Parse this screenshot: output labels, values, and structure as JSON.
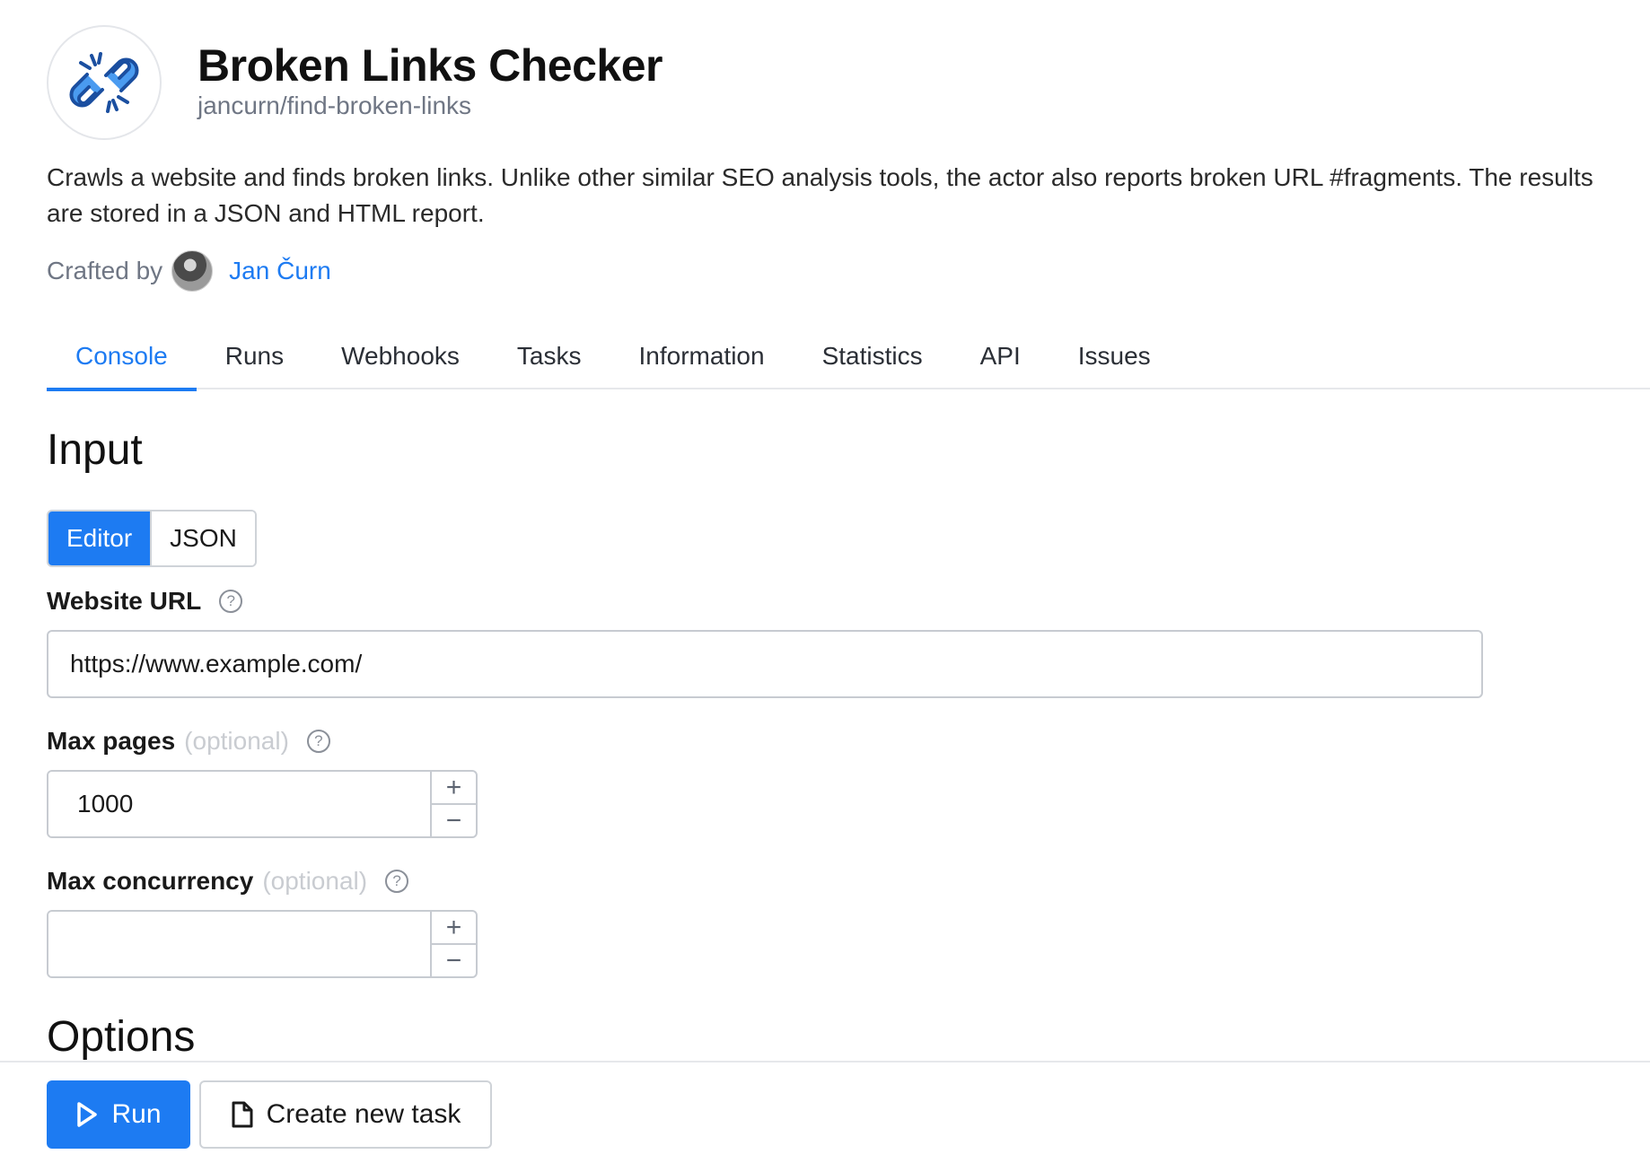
{
  "header": {
    "title": "Broken Links Checker",
    "slug": "jancurn/find-broken-links",
    "logo_icon": "broken-chain-link-icon",
    "description": "Crawls a website and finds broken links. Unlike other similar SEO analysis tools, the actor also reports broken URL #fragments. The results are stored in a JSON and HTML report.",
    "crafted_by_label": "Crafted by",
    "author_name": "Jan Čurn"
  },
  "tabs": [
    {
      "label": "Console",
      "active": true
    },
    {
      "label": "Runs",
      "active": false
    },
    {
      "label": "Webhooks",
      "active": false
    },
    {
      "label": "Tasks",
      "active": false
    },
    {
      "label": "Information",
      "active": false
    },
    {
      "label": "Statistics",
      "active": false
    },
    {
      "label": "API",
      "active": false
    },
    {
      "label": "Issues",
      "active": false
    }
  ],
  "input": {
    "title": "Input",
    "mode_toggle": {
      "editor": "Editor",
      "json": "JSON",
      "selected": "Editor"
    },
    "fields": {
      "website_url": {
        "label": "Website URL",
        "value": "https://www.example.com/"
      },
      "max_pages": {
        "label": "Max pages",
        "optional": "(optional)",
        "value": "1000"
      },
      "max_concurrency": {
        "label": "Max concurrency",
        "optional": "(optional)",
        "value": ""
      }
    },
    "stepper": {
      "plus": "+",
      "minus": "−"
    },
    "help_glyph": "?"
  },
  "options": {
    "title": "Options"
  },
  "footer": {
    "run_label": "Run",
    "create_task_label": "Create new task"
  },
  "colors": {
    "accent": "#1d7bf2",
    "text": "#1a1a1a",
    "muted": "#6f7684",
    "border": "#c7cbd1"
  }
}
